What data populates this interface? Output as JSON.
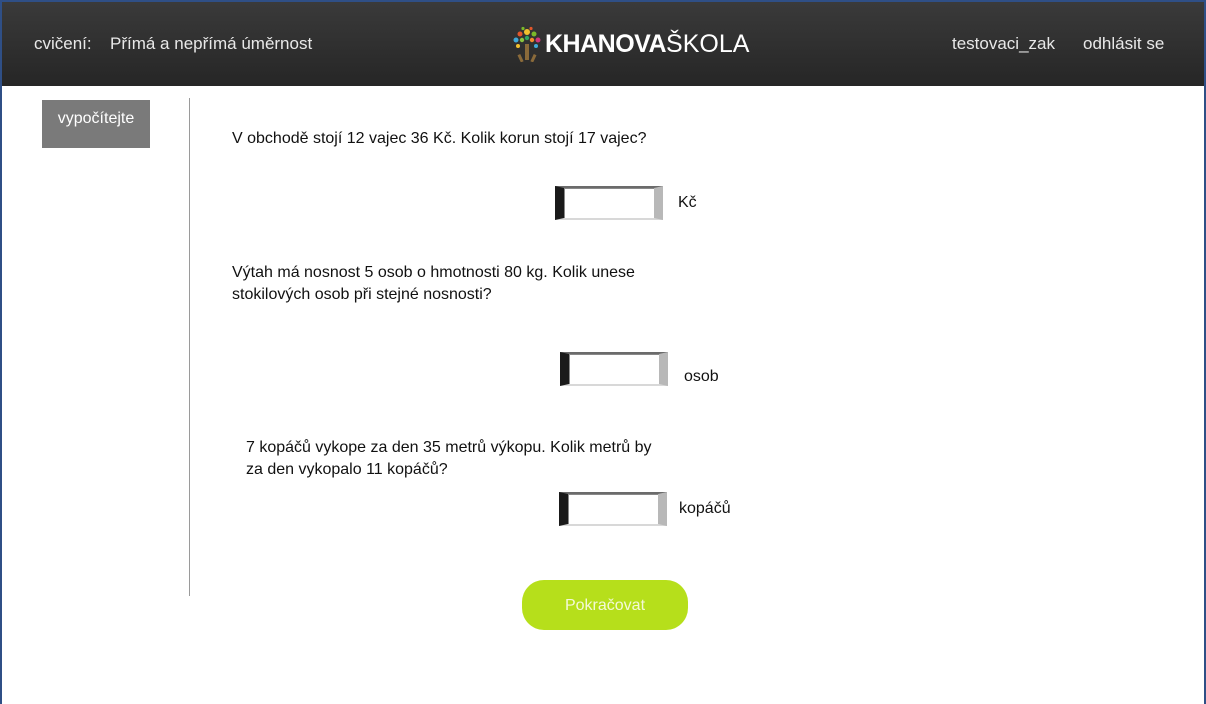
{
  "header": {
    "exercise_prefix": "cvičení:",
    "exercise_title": "Přímá a nepřímá úměrnost",
    "logo_bold": "KHANOVA",
    "logo_light": "ŠKOLA",
    "username": "testovaci_zak",
    "logout_label": "odhlásit se"
  },
  "sidebar": {
    "tab_label": "vypočítejte"
  },
  "questions": [
    {
      "text_lines": [
        "V obchodě stojí 12 vajec 36 Kč. Kolik korun stojí 17 vajec?"
      ],
      "answer_value": "",
      "unit": "Kč"
    },
    {
      "text_lines": [
        "Výtah má nosnost 5 osob o hmotnosti 80 kg. Kolik unese",
        "stokilových osob při stejné nosnosti?"
      ],
      "answer_value": "",
      "unit": "osob"
    },
    {
      "text_lines": [
        "7 kopáčů vykope za den 35 metrů výkopu. Kolik metrů by",
        "za den vykopalo 11 kopáčů?"
      ],
      "answer_value": "",
      "unit": "kopáčů"
    }
  ],
  "continue_label": "Pokračovat",
  "colors": {
    "header_bg": "#2e2e2e",
    "sidebar_tab_bg": "#7a7a7a",
    "continue_bg": "#b6df1b",
    "frame_border": "#2f4f86"
  },
  "icons": {
    "logo": "khan-tree-icon"
  }
}
